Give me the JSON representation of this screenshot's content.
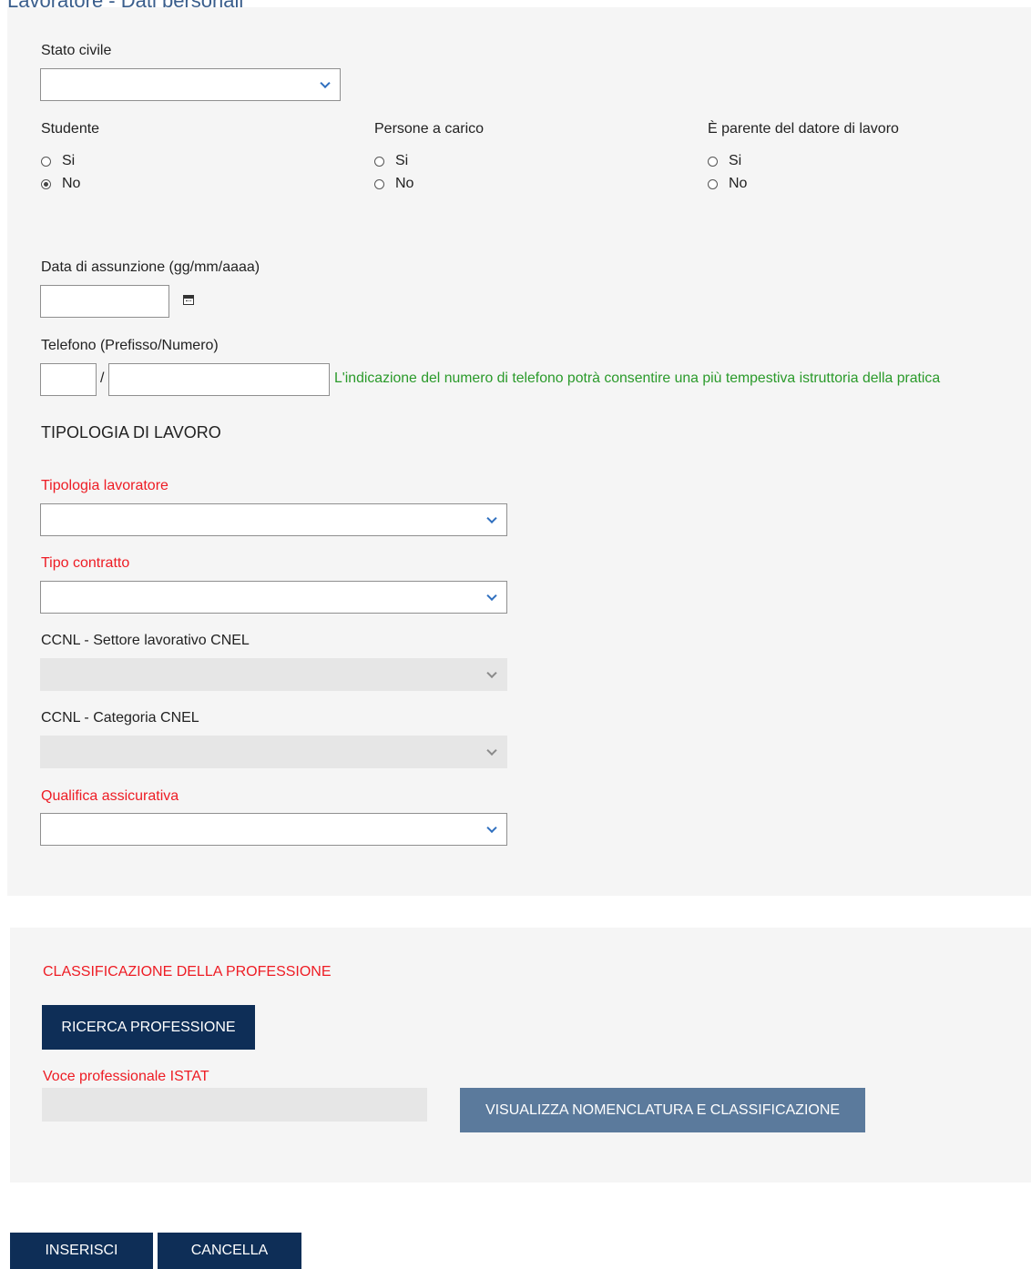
{
  "page": {
    "title": "Lavoratore - Dati personali"
  },
  "personal": {
    "stato_civile_label": "Stato civile",
    "stato_civile_value": "",
    "studente": {
      "label": "Studente",
      "options": [
        "Si",
        "No"
      ],
      "selected": "No"
    },
    "persone_carico": {
      "label": "Persone a carico",
      "options": [
        "Si",
        "No"
      ],
      "selected": ""
    },
    "parente": {
      "label": "È parente del datore di lavoro",
      "options": [
        "Si",
        "No"
      ],
      "selected": ""
    },
    "data_assunzione_label": "Data di assunzione (gg/mm/aaaa)",
    "data_assunzione_value": "",
    "telefono_label": "Telefono (Prefisso/Numero)",
    "telefono_separator": "/",
    "telefono_prefisso": "",
    "telefono_numero": "",
    "telefono_hint": "L'indicazione del numero di telefono potrà consentire una più tempestiva istruttoria della pratica"
  },
  "work": {
    "section_title": "TIPOLOGIA DI LAVORO",
    "tipologia_lavoratore_label": "Tipologia lavoratore",
    "tipo_contratto_label": "Tipo contratto",
    "ccnl_settore_label": "CCNL - Settore lavorativo CNEL",
    "ccnl_categoria_label": "CCNL - Categoria CNEL",
    "qualifica_label": "Qualifica assicurativa"
  },
  "classification": {
    "section_title": "CLASSIFICAZIONE DELLA PROFESSIONE",
    "search_button": "RICERCA PROFESSIONE",
    "istat_label": "Voce professionale ISTAT",
    "istat_value": "",
    "view_button": "VISUALIZZA NOMENCLATURA E CLASSIFICAZIONE"
  },
  "actions": {
    "insert_button": "INSERISCI",
    "cancel_button": "CANCELLA"
  },
  "colors": {
    "required_label": "#ee1c24",
    "hint": "#2a9a2a",
    "primary_button": "#0e2e57",
    "secondary_button": "#5b7a9c",
    "panel_bg": "#f5f5f5"
  }
}
